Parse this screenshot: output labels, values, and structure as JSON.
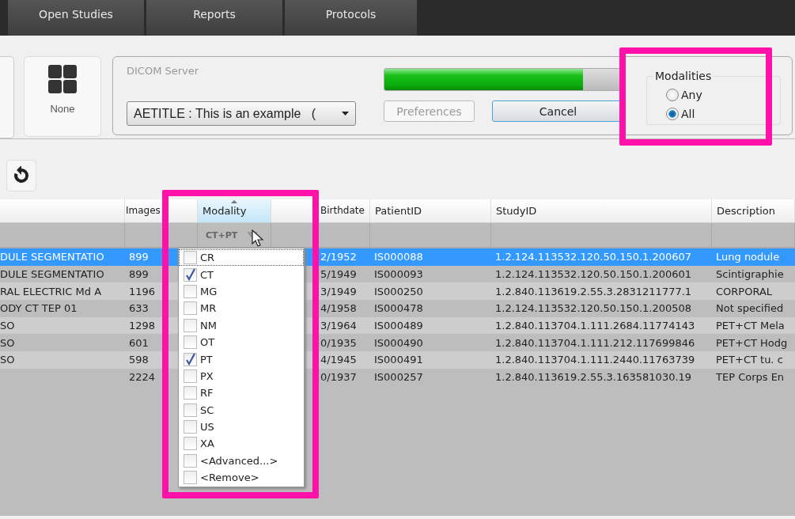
{
  "tabs": [
    {
      "label": "Open Studies"
    },
    {
      "label": "Reports"
    },
    {
      "label": "Protocols"
    }
  ],
  "source_button": {
    "label": "None"
  },
  "dicom_server": {
    "title": "DICOM Server",
    "progress": {
      "level": 0.83
    },
    "server_combo": {
      "value": "AETITLE : This is an example   ("
    },
    "buttons": [
      {
        "label": "Preferences",
        "disabled": true
      },
      {
        "label": "Cancel",
        "disabled": false
      }
    ]
  },
  "modalities": {
    "title": "Modalities",
    "options": [
      {
        "label": "Any",
        "selected": false
      },
      {
        "label": "All",
        "selected": true
      }
    ]
  },
  "table": {
    "columns": [
      {
        "sorted": false
      },
      {
        "label": "Images",
        "sorted": false
      },
      {
        "label": "Modality",
        "sorted": true,
        "filter": "CT+PT"
      },
      {
        "label": "Birthdate",
        "sorted": false
      },
      {
        "label": "PatientID",
        "sorted": false
      },
      {
        "label": "StudyID",
        "sorted": false
      },
      {
        "label": "Description",
        "sorted": false
      }
    ],
    "rows": [
      {
        "selected": true,
        "cells": [
          "DULE SEGMENTATIO",
          "899",
          null,
          "2/1952",
          "IS000088",
          "1.2.124.113532.120.50.150.1.200607",
          "Lung nodule"
        ]
      },
      {
        "selected": false,
        "cells": [
          "DULE SEGMENTATIO",
          "899",
          null,
          "5/1949",
          "IS000093",
          "1.2.124.113532.120.50.150.1.200601",
          "Scintigraphie"
        ]
      },
      {
        "selected": false,
        "cells": [
          "RAL ELECTRIC Md A",
          "1196",
          null,
          "3/1949",
          "IS000250",
          "1.2.840.113619.2.55.3.2831211777.1",
          "CORPORAL"
        ]
      },
      {
        "selected": false,
        "cells": [
          "ODY CT TEP 01",
          "633",
          null,
          "4/1958",
          "IS000478",
          "1.2.124.113532.120.50.150.1.200508",
          "Not specified"
        ]
      },
      {
        "selected": false,
        "cells": [
          "SO",
          "1298",
          null,
          "3/1964",
          "IS000489",
          "1.2.840.113704.1.111.2684.11774143",
          "PET+CT Mela"
        ]
      },
      {
        "selected": false,
        "cells": [
          "SO",
          "601",
          null,
          "0/1935",
          "IS000490",
          "1.2.840.113704.1.111.212.117699846",
          "PET+CT Hodg"
        ]
      },
      {
        "selected": false,
        "cells": [
          "SO",
          "598",
          null,
          "4/1945",
          "IS000491",
          "1.2.840.113704.1.111.2440.11763739",
          "PET+CT tu. c"
        ]
      },
      {
        "selected": false,
        "cells": [
          null,
          "2224",
          null,
          "0/1937",
          "IS000257",
          "1.2.840.113619.2.55.3.163581030.19",
          "TEP Corps En"
        ]
      }
    ]
  },
  "modality_dropdown": {
    "items": [
      {
        "label": "CR",
        "checked": false,
        "focused": true
      },
      {
        "label": "CT",
        "checked": true,
        "focused": false
      },
      {
        "label": "MG",
        "checked": false,
        "focused": false
      },
      {
        "label": "MR",
        "checked": false,
        "focused": false
      },
      {
        "label": "NM",
        "checked": false,
        "focused": false
      },
      {
        "label": "OT",
        "checked": false,
        "focused": false
      },
      {
        "label": "PT",
        "checked": true,
        "focused": false
      },
      {
        "label": "PX",
        "checked": false,
        "focused": false
      },
      {
        "label": "RF",
        "checked": false,
        "focused": false
      },
      {
        "label": "SC",
        "checked": false,
        "focused": false
      },
      {
        "label": "US",
        "checked": false,
        "focused": false
      },
      {
        "label": "XA",
        "checked": false,
        "focused": false
      },
      {
        "label": "<Advanced...>",
        "checked": false,
        "focused": false
      },
      {
        "label": "<Remove>",
        "checked": false,
        "focused": false
      }
    ]
  }
}
